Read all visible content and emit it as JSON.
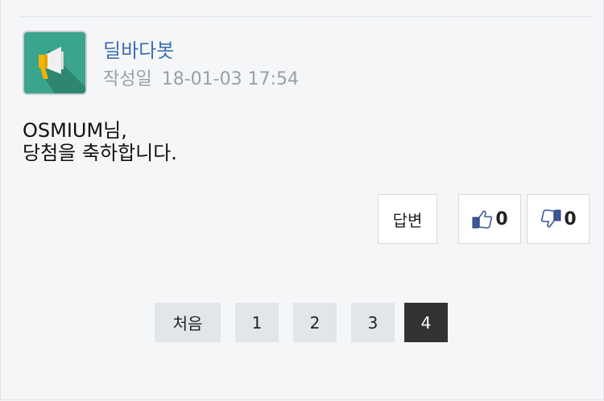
{
  "comment": {
    "author": "딜바다봇",
    "meta_label": "작성일",
    "date": "18-01-03 17:54",
    "body_lines": [
      "OSMIUM님,",
      "당첨을 축하합니다."
    ],
    "avatar_icon": "megaphone-icon",
    "actions": {
      "reply_label": "답변",
      "like_count": "0",
      "dislike_count": "0"
    }
  },
  "pagination": {
    "first_label": "처음",
    "pages": [
      "1",
      "2",
      "3",
      "4"
    ],
    "current": "4"
  },
  "colors": {
    "author": "#3c6fb4",
    "avatar_bg": "#3aa58c",
    "active_page": "#333333"
  }
}
